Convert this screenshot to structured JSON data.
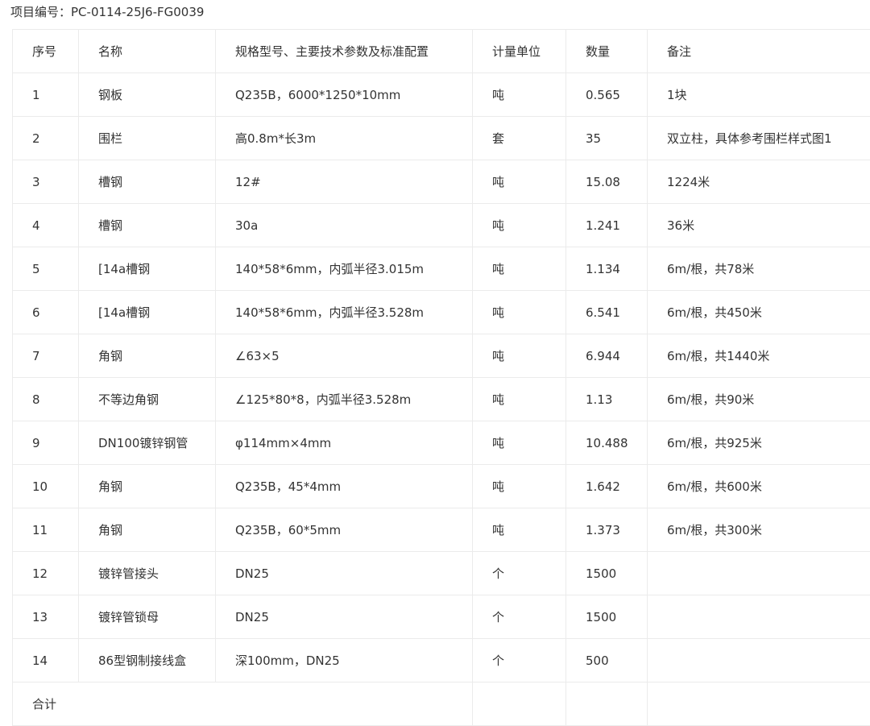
{
  "project": {
    "label": "项目编号：",
    "code": "PC-0114-25J6-FG0039"
  },
  "table": {
    "headers": [
      "序号",
      "名称",
      "规格型号、主要技术参数及标准配置",
      "计量单位",
      "数量",
      "备注"
    ],
    "rows": [
      [
        "1",
        "钢板",
        "Q235B，6000*1250*10mm",
        "吨",
        "0.565",
        "1块"
      ],
      [
        "2",
        "围栏",
        "高0.8m*长3m",
        "套",
        "35",
        "双立柱，具体参考围栏样式图1"
      ],
      [
        "3",
        "槽钢",
        "12#",
        "吨",
        "15.08",
        "1224米"
      ],
      [
        "4",
        "槽钢",
        "30a",
        "吨",
        "1.241",
        "36米"
      ],
      [
        "5",
        "[14a槽钢",
        "140*58*6mm，内弧半径3.015m",
        "吨",
        "1.134",
        "6m/根，共78米"
      ],
      [
        "6",
        "[14a槽钢",
        "140*58*6mm，内弧半径3.528m",
        "吨",
        "6.541",
        "6m/根，共450米"
      ],
      [
        "7",
        "角钢",
        "∠63×5",
        "吨",
        "6.944",
        "6m/根，共1440米"
      ],
      [
        "8",
        "不等边角钢",
        "∠125*80*8，内弧半径3.528m",
        "吨",
        "1.13",
        "6m/根，共90米"
      ],
      [
        "9",
        "DN100镀锌钢管",
        "φ114mm×4mm",
        "吨",
        "10.488",
        "6m/根，共925米"
      ],
      [
        "10",
        "角钢",
        "Q235B，45*4mm",
        "吨",
        "1.642",
        "6m/根，共600米"
      ],
      [
        "11",
        "角钢",
        "Q235B，60*5mm",
        "吨",
        "1.373",
        "6m/根，共300米"
      ],
      [
        "12",
        "镀锌管接头",
        "DN25",
        "个",
        "1500",
        ""
      ],
      [
        "13",
        "镀锌管锁母",
        "DN25",
        "个",
        "1500",
        ""
      ],
      [
        "14",
        "86型钢制接线盒",
        "深100mm，DN25",
        "个",
        "500",
        ""
      ]
    ],
    "total_label": "合计"
  },
  "colors": {
    "text": "#333333",
    "border": "#ebebeb",
    "background": "#ffffff"
  }
}
